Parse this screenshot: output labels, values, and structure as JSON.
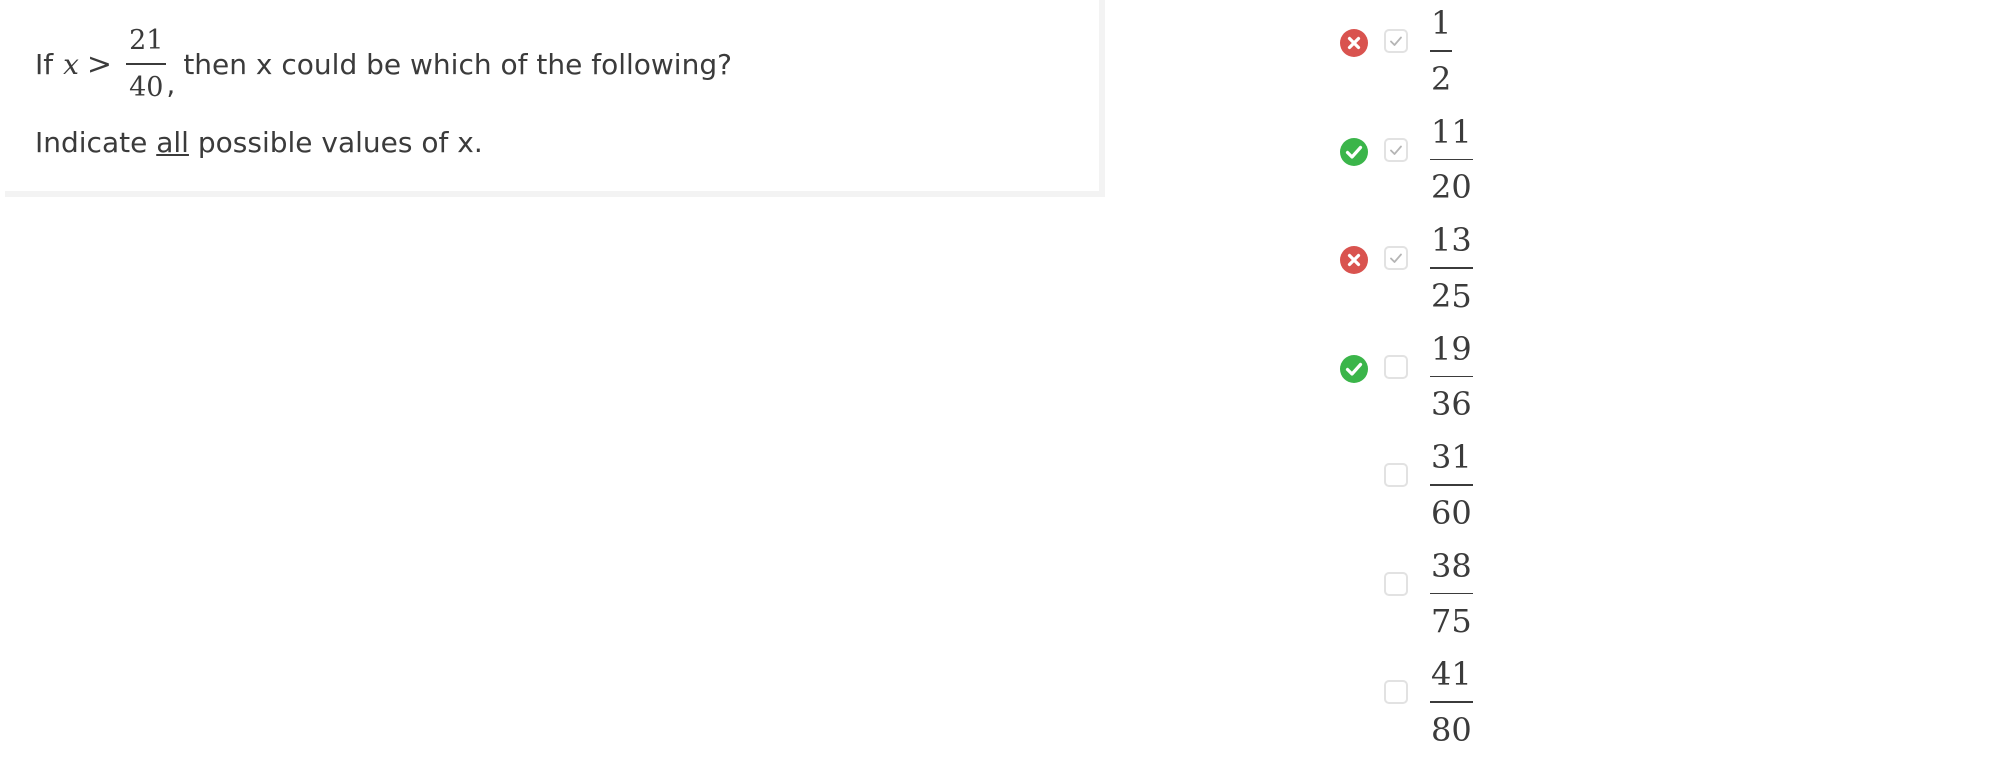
{
  "question": {
    "prefix": "If",
    "variable": "x",
    "operator": ">",
    "fraction": {
      "numerator": "21",
      "denominator": "40"
    },
    "comma": ",",
    "suffix": "then x could be which of the following?",
    "instruction_before": "Indicate",
    "instruction_emphasis": "all",
    "instruction_after": "possible values of x."
  },
  "choices": [
    {
      "numerator": "1",
      "denominator": "2",
      "checked": true,
      "status": "incorrect",
      "status_icon": "x-circle-icon"
    },
    {
      "numerator": "11",
      "denominator": "20",
      "checked": true,
      "status": "correct",
      "status_icon": "check-circle-icon"
    },
    {
      "numerator": "13",
      "denominator": "25",
      "checked": true,
      "status": "incorrect",
      "status_icon": "x-circle-icon"
    },
    {
      "numerator": "19",
      "denominator": "36",
      "checked": false,
      "status": "correct",
      "status_icon": "check-circle-icon"
    },
    {
      "numerator": "31",
      "denominator": "60",
      "checked": false,
      "status": "none",
      "status_icon": ""
    },
    {
      "numerator": "38",
      "denominator": "75",
      "checked": false,
      "status": "none",
      "status_icon": ""
    },
    {
      "numerator": "41",
      "denominator": "80",
      "checked": false,
      "status": "none",
      "status_icon": ""
    }
  ],
  "colors": {
    "correct": "#3bb54a",
    "incorrect": "#d9534f",
    "checkmark": "#b5b5b5",
    "text": "#3b3b3b"
  }
}
